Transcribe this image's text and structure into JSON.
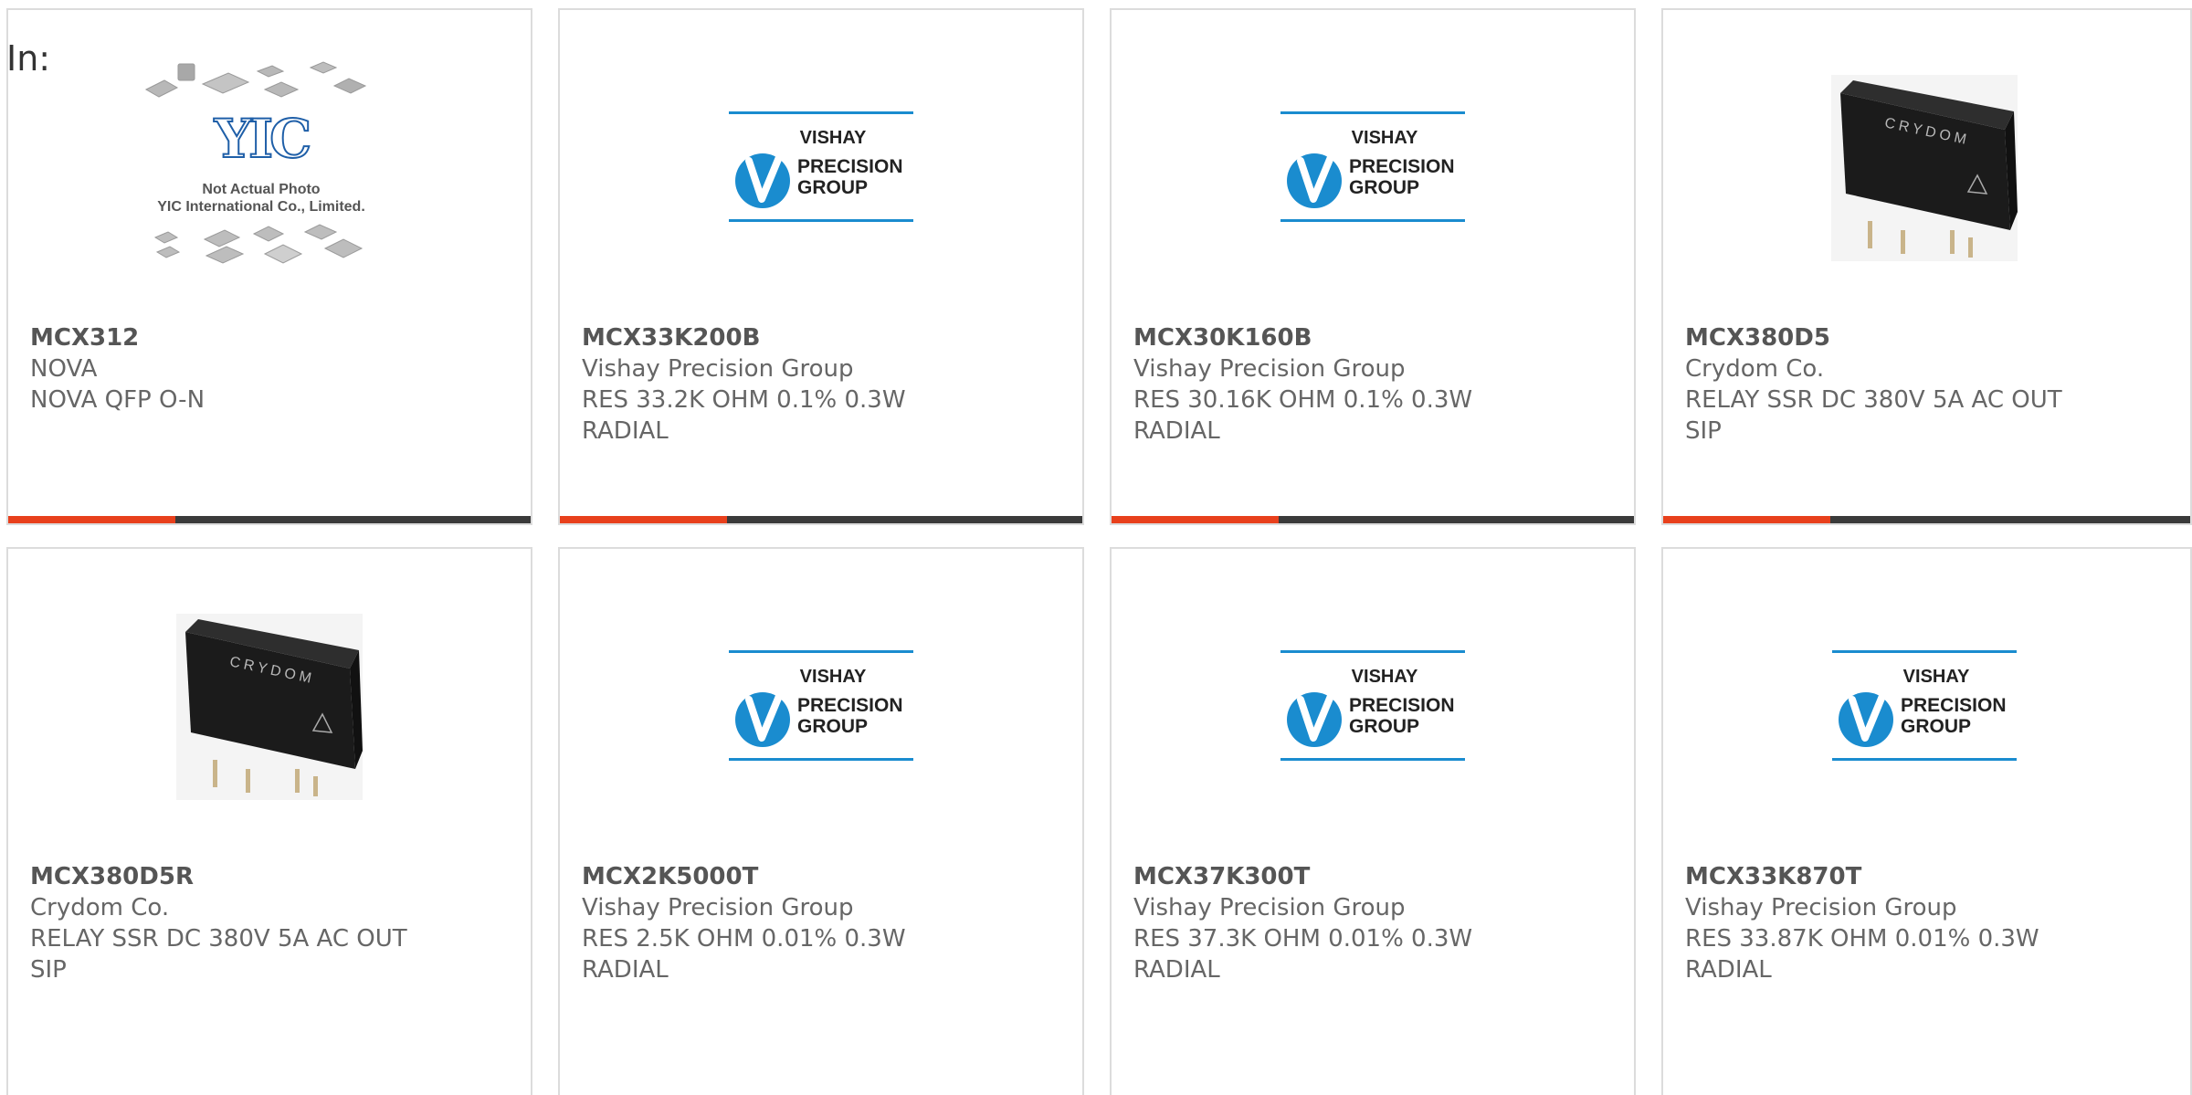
{
  "page": {
    "heading": "In:"
  },
  "colors": {
    "accent_bar": "#e8401c",
    "dark_bar": "#3a3a3a",
    "vishay_blue": "#1a8ccf",
    "card_border": "#dcdcdc"
  },
  "yic_placeholder": {
    "logo_text": "YIC",
    "caption_line1": "Not Actual Photo",
    "caption_line2": "YIC International Co., Limited."
  },
  "vishay_logo": {
    "line1": "VISHAY",
    "line2": "PRECISION",
    "line3": "GROUP"
  },
  "crydom_logo": {
    "brand": "CRYDOM"
  },
  "products": [
    {
      "part_number": "MCX312",
      "manufacturer": "NOVA",
      "description": "NOVA QFP O-N",
      "image": "yic-placeholder"
    },
    {
      "part_number": "MCX33K200B",
      "manufacturer": "Vishay Precision Group",
      "description": "RES 33.2K OHM 0.1% 0.3W RADIAL",
      "image": "vishay-logo"
    },
    {
      "part_number": "MCX30K160B",
      "manufacturer": "Vishay Precision Group",
      "description": "RES 30.16K OHM 0.1% 0.3W RADIAL",
      "image": "vishay-logo"
    },
    {
      "part_number": "MCX380D5",
      "manufacturer": "Crydom Co.",
      "description": "RELAY SSR DC 380V 5A AC OUT SIP",
      "image": "crydom-relay"
    },
    {
      "part_number": "MCX380D5R",
      "manufacturer": "Crydom Co.",
      "description": "RELAY SSR DC 380V 5A AC OUT SIP",
      "image": "crydom-relay"
    },
    {
      "part_number": "MCX2K5000T",
      "manufacturer": "Vishay Precision Group",
      "description": "RES 2.5K OHM 0.01% 0.3W RADIAL",
      "image": "vishay-logo"
    },
    {
      "part_number": "MCX37K300T",
      "manufacturer": "Vishay Precision Group",
      "description": "RES 37.3K OHM 0.01% 0.3W RADIAL",
      "image": "vishay-logo"
    },
    {
      "part_number": "MCX33K870T",
      "manufacturer": "Vishay Precision Group",
      "description": "RES 33.87K OHM 0.01% 0.3W RADIAL",
      "image": "vishay-logo"
    }
  ]
}
